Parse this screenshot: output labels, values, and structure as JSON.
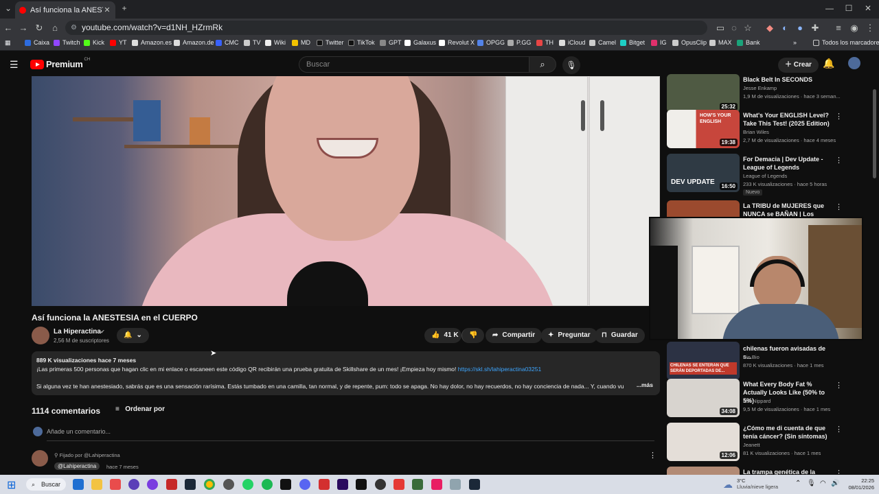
{
  "browser": {
    "tab_title": "Así funciona la ANESTESIA en el",
    "url": "youtube.com/watch?v=d1NH_HZrmRk",
    "bookmarks": [
      "Caixa",
      "Twitch",
      "Kick",
      "YT",
      "Amazon.es",
      "Amazon.de",
      "CMC",
      "TV",
      "Wiki",
      "MD",
      "Twitter",
      "TikTok",
      "GPT",
      "Galaxus",
      "Revolut X",
      "OPGG",
      "P.GG",
      "TH",
      "iCloud",
      "Camel",
      "Bitget",
      "IG",
      "OpusClip",
      "MAX",
      "Bank"
    ],
    "all_bookmarks": "Todos los marcadores"
  },
  "yt": {
    "logo": "Premium",
    "country": "CH",
    "search_placeholder": "Buscar",
    "create": "Crear"
  },
  "video": {
    "title": "Así funciona la ANESTESIA en el CUERPO",
    "channel": "La Hiperactina",
    "subscribers": "2,56 M de suscriptores",
    "likes": "41 K",
    "share": "Compartir",
    "ask": "Preguntar",
    "save": "Guardar",
    "views_date": "889 K visualizaciones  hace 7 meses",
    "desc_line1": "¡Las primeras 500 personas que hagan clic en mi enlace o escaneen este código QR recibirán una prueba gratuita de Skillshare de un mes! ¡Empieza hoy mismo!",
    "desc_link": "https://skl.sh/lahiperactina03251",
    "desc_line2": "Si alguna vez te han anestesiado, sabrás que es una sensación rarísima. Estás tumbado en una camilla, tan normal, y de repente, pum: todo se apaga. No hay dolor, no hay recuerdos, no hay conciencia de nada... Y, cuando vu",
    "more": "...más"
  },
  "comments": {
    "count": "1114 comentarios",
    "sort": "Ordenar por",
    "add_placeholder": "Añade un comentario...",
    "pinned_by": "Fijado por @Lahiperactina",
    "first_author": "@Lahiperactina",
    "first_date": "hace 7 meses"
  },
  "sidebar": [
    {
      "title": "Black Belt In SECONDS",
      "channel": "Jesse Enkamp",
      "meta": "1,9 M de visualizaciones · hace 3 seman...",
      "duration": "25:32",
      "color": "#4f5a43"
    },
    {
      "title": "What's Your ENGLISH Level? Take This Test! (2025 Edition)",
      "channel": "Brian Wiles",
      "meta": "2,7 M de visualizaciones · hace 4 meses",
      "duration": "19:38",
      "color": "#c7463c"
    },
    {
      "title": "For Demacia | Dev Update - League of Legends",
      "channel": "League of Legends",
      "meta": "233 K visualizaciones · hace 5 horas",
      "duration": "16:50",
      "color": "#2f3a44",
      "badge": "Nuevo"
    },
    {
      "title": "La TRIBU de MUJERES que NUNCA se BAÑAN | Los Himba",
      "channel": "",
      "meta": "",
      "duration": "",
      "color": "#9b4a2e"
    },
    {
      "title": "chilenas fueron avisadas de s...",
      "channel": "Bio Bio",
      "meta": "870 K visualizaciones · hace 1 mes",
      "duration": "",
      "color": "#2c3244"
    },
    {
      "title": "What Every Body Fat % Actually Looks Like (50% to 5%)",
      "channel": "Jeff Nippard",
      "meta": "9,5 M de visualizaciones · hace 1 mes",
      "duration": "34:08",
      "color": "#d8d4cf"
    },
    {
      "title": "¿Cómo me di cuenta de que tenía cáncer? (Sin síntomas)",
      "channel": "Jeanett",
      "meta": "81 K visualizaciones · hace 1 mes",
      "duration": "12:06",
      "color": "#e4ded8"
    },
    {
      "title": "La trampa genética de la",
      "channel": "",
      "meta": "",
      "duration": "",
      "color": "#b28a75"
    }
  ],
  "thumb_text": {
    "english": "HOW'S YOUR ENGLISH",
    "dev": "DEV UPDATE",
    "chile": "CHILENAS SE ENTERAN QUE SERÁN DEPORTADAS DE..."
  },
  "taskbar": {
    "search": "Buscar",
    "weather_temp": "3°C",
    "weather_desc": "Lluvia/nieve ligera",
    "time": "22:25",
    "date": "08/01/2026"
  }
}
